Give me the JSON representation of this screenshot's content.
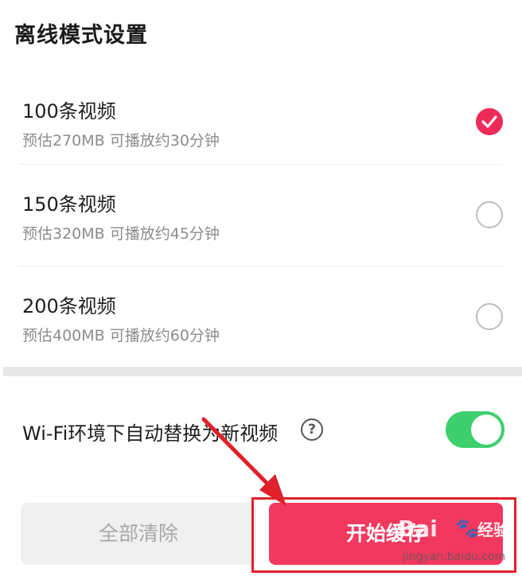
{
  "page": {
    "title": "离线模式设置"
  },
  "options": [
    {
      "label": "100条视频",
      "description": "预估270MB 可播放约30分钟",
      "selected": true
    },
    {
      "label": "150条视频",
      "description": "预估320MB 可播放约45分钟",
      "selected": false
    },
    {
      "label": "200条视频",
      "description": "预估400MB 可播放约60分钟",
      "selected": false
    }
  ],
  "wifi": {
    "label": "Wi-Fi环境下自动替换为新视频",
    "help_icon": "?",
    "enabled": true
  },
  "buttons": {
    "clear_label": "全部清除",
    "start_label": "开始缓存"
  },
  "watermark": {
    "logo": "Bai",
    "brand": "经验",
    "url": "jingyan.baidu.com"
  },
  "colors": {
    "accent": "#f2385e",
    "toggle_on": "#3ecf6f",
    "annotation": "#e0202a"
  }
}
